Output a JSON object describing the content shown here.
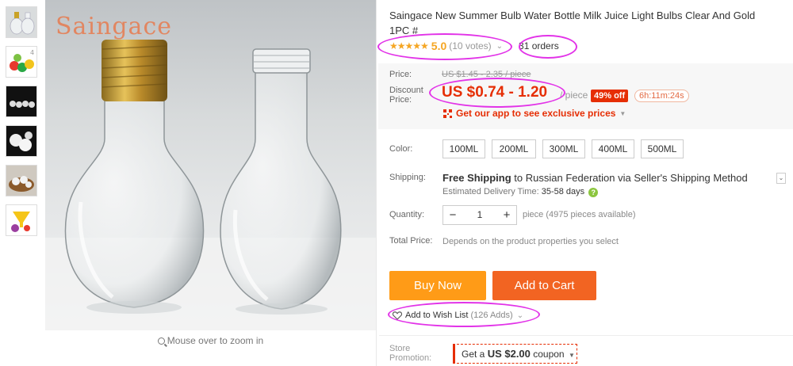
{
  "brand_watermark": "Saingace",
  "zoom_hint": "Mouse over to zoom in",
  "thumbnail_icons": [
    "bulb-bottles-thumb",
    "colored-bulbs-thumb",
    "dark-bulbs-thumb",
    "white-bulbs-thumb",
    "bulbs-in-basket-thumb",
    "yellow-funnel-thumb"
  ],
  "product": {
    "title": "Saingace New Summer Bulb Water Bottle Milk Juice Light Bulbs Clear And Gold 1PC #",
    "stars": "★★★★★",
    "rating": "5.0",
    "votes": "(10 votes)",
    "orders": "31 orders"
  },
  "price": {
    "price_label": "Price:",
    "original": "US $1.45 - 2.35 / piece",
    "discount_label_1": "Discount",
    "discount_label_2": "Price:",
    "discounted": "US $0.74 - 1.20",
    "unit": "/ piece",
    "discount_badge": "49% off",
    "countdown": "6h:11m:24s",
    "app_promo": "Get our app to see exclusive prices",
    "accent_color": "#e62e04"
  },
  "color": {
    "label": "Color:",
    "options": [
      "100ML",
      "200ML",
      "300ML",
      "400ML",
      "500ML"
    ]
  },
  "shipping": {
    "label": "Shipping:",
    "free": "Free Shipping",
    "to": " to ",
    "country": "Russian Federation",
    "via": " via ",
    "method": "Seller's Shipping Method",
    "eta_label": "Estimated Delivery Time: ",
    "eta_days": "35-58 days"
  },
  "quantity": {
    "label": "Quantity:",
    "minus": "−",
    "value": "1",
    "plus": "+",
    "available": "piece (4975 pieces available)"
  },
  "total": {
    "label": "Total Price:",
    "text": "Depends on the product properties you select"
  },
  "actions": {
    "buy_now": "Buy Now",
    "add_to_cart": "Add to Cart",
    "buy_color": "#ff9b17",
    "cart_color": "#f26422",
    "wish_list": "Add to Wish List",
    "wish_count": "(126 Adds)"
  },
  "store_promo": {
    "label_1": "Store",
    "label_2": "Promotion:",
    "coupon_prefix": "Get a ",
    "coupon_amount": "US $2.00",
    "coupon_suffix": " coupon"
  },
  "annotation_color": "#e233e8"
}
